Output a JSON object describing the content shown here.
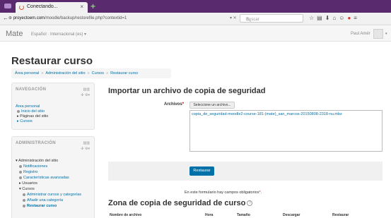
{
  "browser": {
    "tab_title": "Conectando...",
    "tab_close": "×",
    "new_tab": "+",
    "url_domain": "proyectoem.com",
    "url_path": "/moodle/backup/restorefile.php?contextid=1",
    "search_placeholder": "Buscar"
  },
  "moodle_header": {
    "brand": "Mate",
    "language": "Español · Internacional (es) ▾",
    "user_name": "Paul Amér"
  },
  "page": {
    "title": "Restaurar curso",
    "breadcrumb": [
      "Área personal",
      "Administración del sitio",
      "Cursos",
      "Restaurar curso"
    ],
    "breadcrumb_sep": "»"
  },
  "navigation_block": {
    "title": "NAVEGACIÓN",
    "items": [
      "Área personal",
      "Inicio del sitio",
      "Páginas del sitio",
      "Cursos"
    ]
  },
  "admin_block": {
    "title": "ADMINISTRACIÓN",
    "items": [
      "Administración del sitio",
      "Notificaciones",
      "Registro",
      "Características avanzadas",
      "Usuarios",
      "Cursos",
      "Administrar cursos y categorías",
      "Añadir una categoría",
      "Restaurar curso"
    ]
  },
  "main": {
    "import_heading": "Importar un archivo de copia de seguridad",
    "files_label": "Archivos",
    "required_mark": "*",
    "choose_button": "Seleccione un archivo...",
    "selected_file": "copia_de_seguridad-moodle2-course-181-(mate)_san_marcos-20150808-2318-nu.mbz",
    "restore_button": "Restaurar",
    "required_note": "En este formulario hay campos obligatorios",
    "zone_heading": "Zona de copia de seguridad de curso",
    "table_headers": [
      "Nombre de archivo",
      "Hora",
      "Tamaño",
      "Descargar",
      "Restaurar"
    ]
  }
}
